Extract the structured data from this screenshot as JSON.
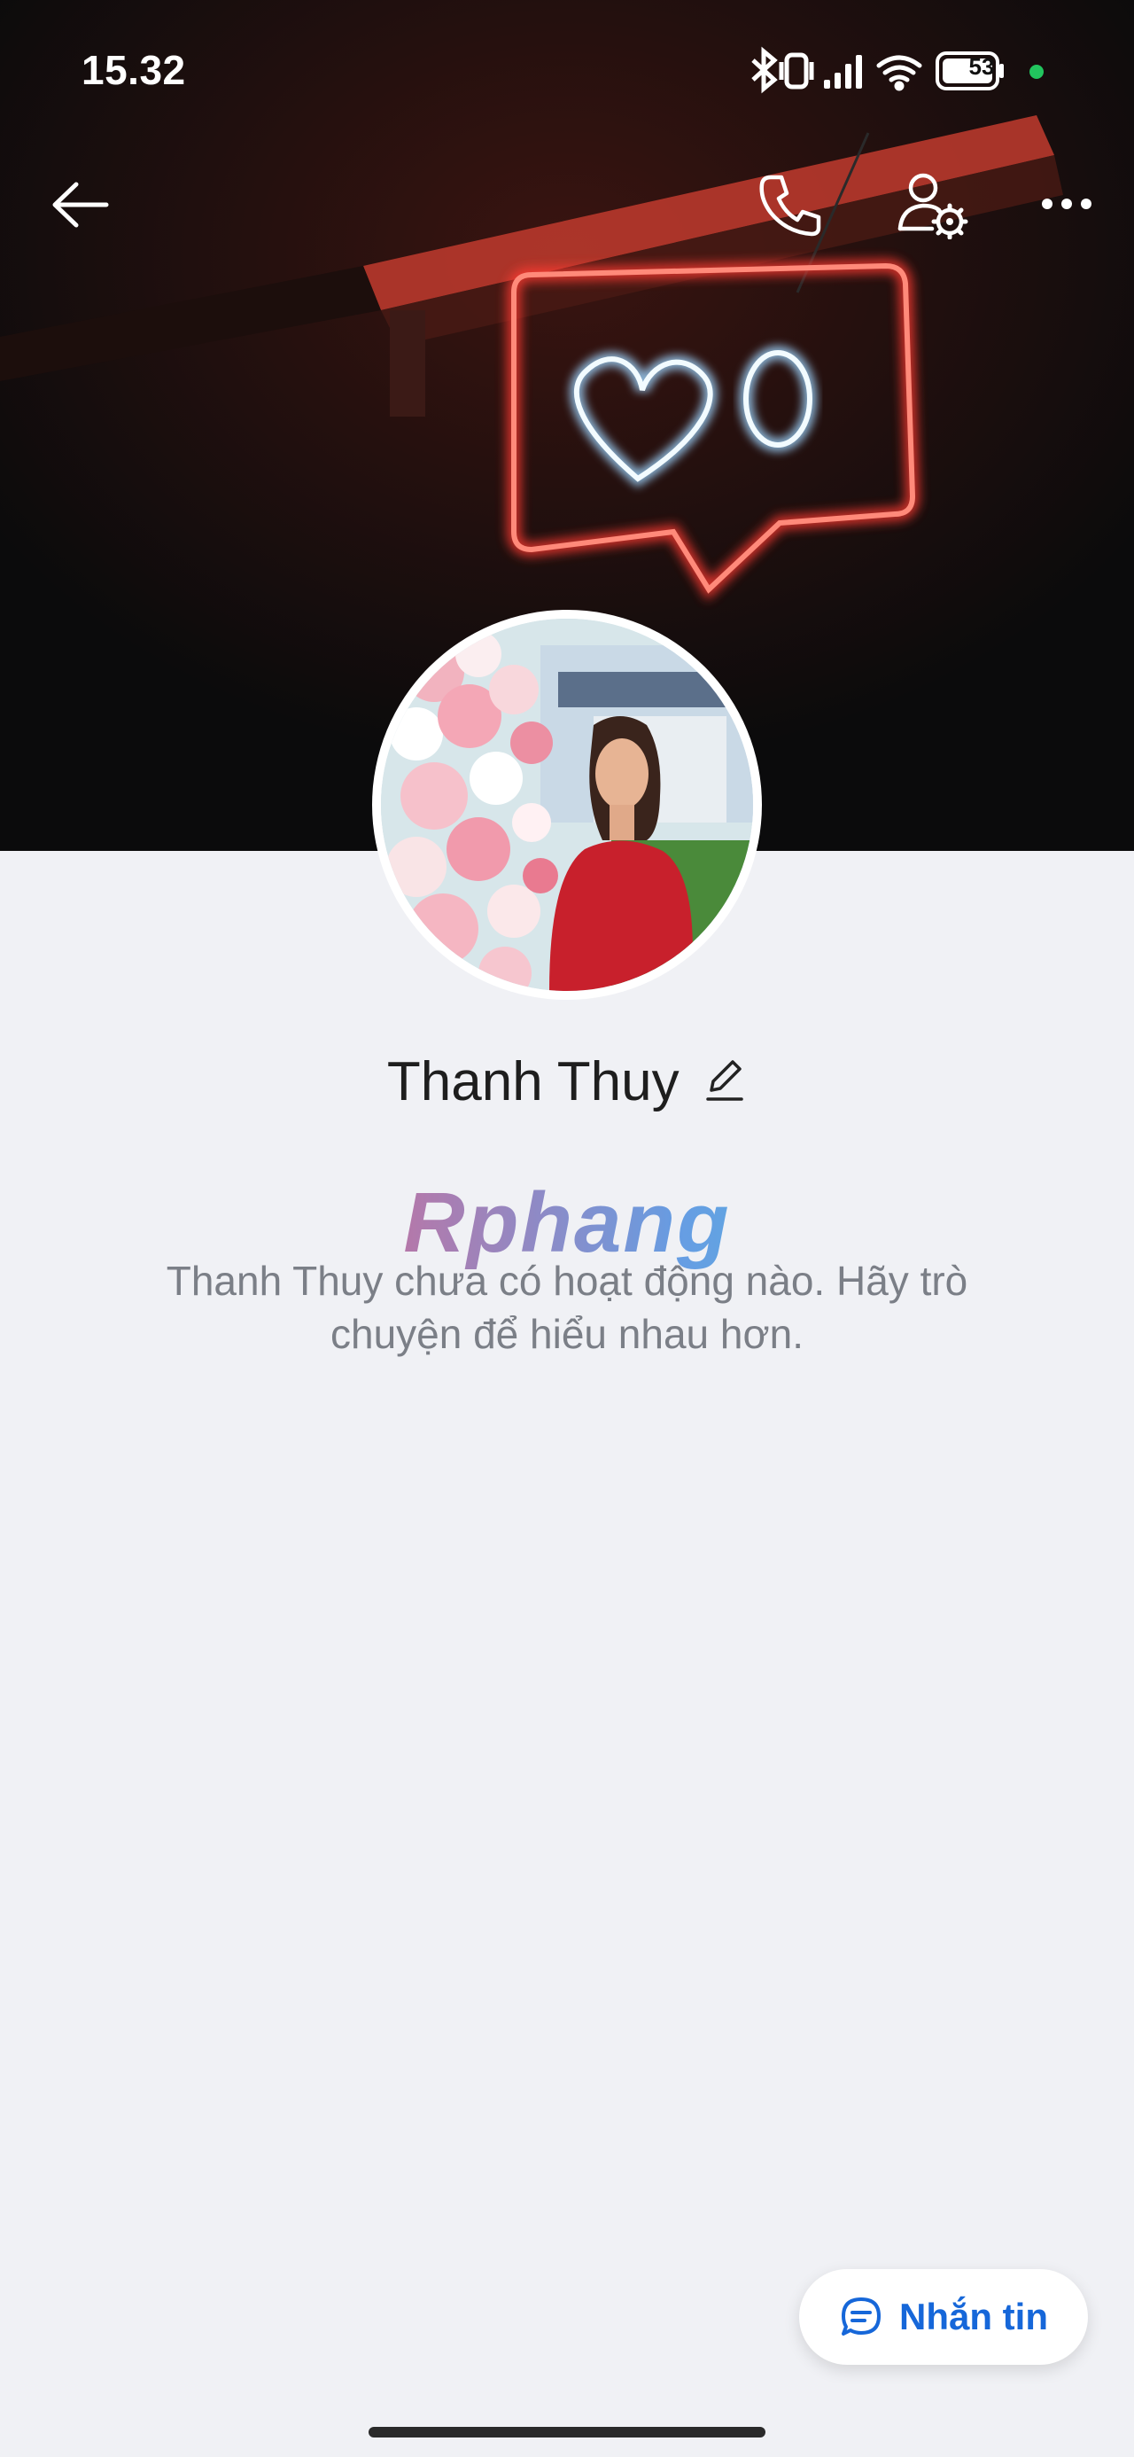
{
  "status_bar": {
    "time": "15.32",
    "battery_level": "53",
    "icons": [
      "bluetooth-icon",
      "vibrate-icon",
      "signal-icon",
      "wifi-icon",
      "battery-icon",
      "privacy-dot-icon"
    ]
  },
  "top_bar": {
    "back_icon": "arrow-left-icon",
    "call_icon": "phone-icon",
    "settings_icon": "user-settings-icon",
    "more_icon": "more-horizontal-icon"
  },
  "profile": {
    "name": "Thanh Thuy",
    "edit_icon": "pencil-icon"
  },
  "watermark": "Rphang",
  "empty_state": {
    "message": "Thanh Thuy chưa có hoạt động nào. Hãy trò chuyện để hiểu nhau hơn."
  },
  "actions": {
    "message_label": "Nhắn tin",
    "message_icon": "chat-bubble-icon"
  },
  "colors": {
    "accent": "#1667d9",
    "neon_red": "#ff3b30",
    "neon_white": "#e8f4ff",
    "background": "#f0f1f5"
  }
}
